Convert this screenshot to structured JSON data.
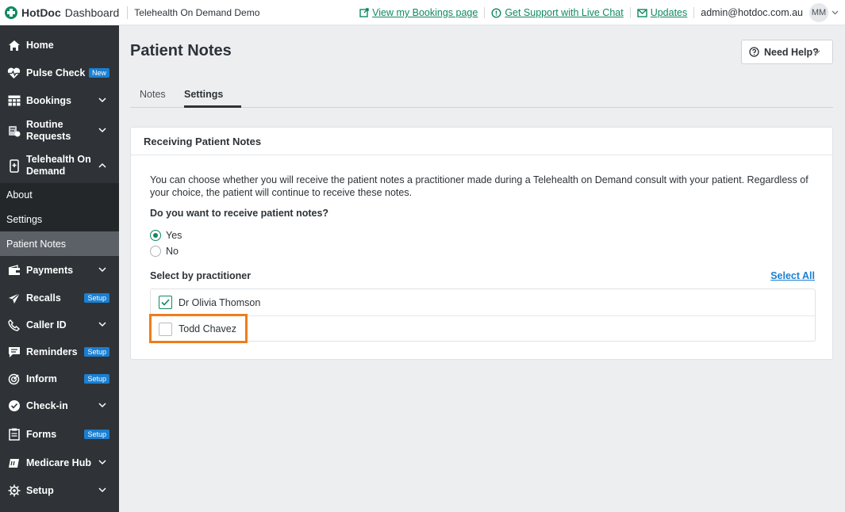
{
  "brand": {
    "name": "HotDoc",
    "section": "Dashboard",
    "clinic": "Telehealth On Demand Demo"
  },
  "top_links": {
    "bookings": "View my Bookings page",
    "support": "Get Support with Live Chat",
    "updates": "Updates"
  },
  "user": {
    "email": "admin@hotdoc.com.au",
    "initials": "MM"
  },
  "sidebar": {
    "items": [
      {
        "label": "Home",
        "icon": "home-icon"
      },
      {
        "label": "Pulse Check",
        "badge": "New",
        "icon": "heart-pulse-icon"
      },
      {
        "label": "Bookings",
        "icon": "calendar-grid-icon"
      },
      {
        "label": "Routine Requests",
        "icon": "routine-requests-icon"
      },
      {
        "label": "Telehealth On Demand",
        "icon": "phone-device-icon"
      },
      {
        "label": "Payments",
        "icon": "wallet-icon"
      },
      {
        "label": "Recalls",
        "badge": "Setup",
        "icon": "paper-plane-icon"
      },
      {
        "label": "Caller ID",
        "icon": "phone-icon"
      },
      {
        "label": "Reminders",
        "badge": "Setup",
        "icon": "chat-bubble-icon"
      },
      {
        "label": "Inform",
        "badge": "Setup",
        "icon": "target-icon"
      },
      {
        "label": "Check-in",
        "icon": "check-circle-icon"
      },
      {
        "label": "Forms",
        "badge": "Setup",
        "icon": "clipboard-icon"
      },
      {
        "label": "Medicare Hub",
        "icon": "medicare-card-icon"
      },
      {
        "label": "Setup",
        "icon": "gear-icon"
      }
    ],
    "sub_items": [
      {
        "label": "About"
      },
      {
        "label": "Settings"
      },
      {
        "label": "Patient Notes",
        "active": true
      }
    ]
  },
  "page": {
    "title": "Patient Notes",
    "help_button": "Need Help?",
    "tabs": [
      {
        "label": "Notes"
      },
      {
        "label": "Settings",
        "active": true
      }
    ]
  },
  "card": {
    "title": "Receiving Patient Notes",
    "description": "You can choose whether you will receive the patient notes a practitioner made during a Telehealth on Demand consult with your patient. Regardless of your choice, the patient will continue to receive these notes.",
    "question": "Do you want to receive patient notes?",
    "options": [
      {
        "label": "Yes",
        "selected": true
      },
      {
        "label": "No",
        "selected": false
      }
    ],
    "select_by_label": "Select by practitioner",
    "select_all": "Select All",
    "practitioners": [
      {
        "name": "Dr Olivia Thomson",
        "checked": true
      },
      {
        "name": "Todd Chavez",
        "checked": false
      }
    ]
  },
  "colors": {
    "accent_green": "#0f8a5f",
    "link_blue": "#1b7fd1",
    "sidebar_bg": "#2f3337",
    "highlight_orange": "#ef7d1a"
  }
}
